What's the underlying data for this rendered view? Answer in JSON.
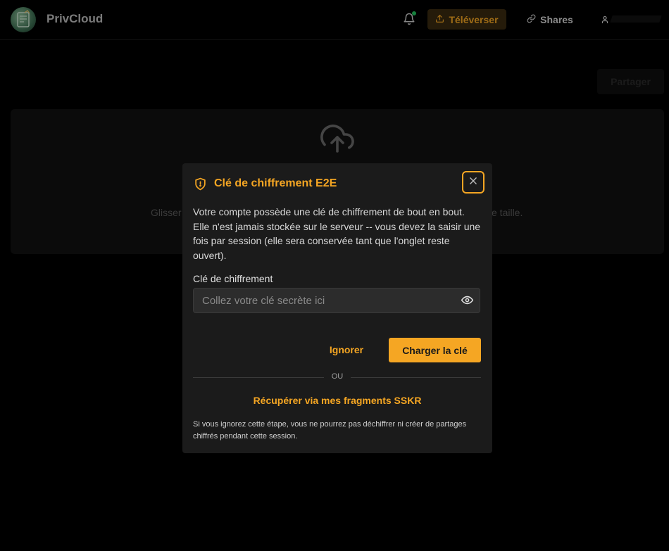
{
  "header": {
    "brand": "PrivCloud",
    "upload_label": "Téléverser",
    "shares_label": "Shares",
    "notification_color": "#22c55e"
  },
  "page": {
    "share_button": "Partager",
    "dropzone_text_left": "Glisser",
    "dropzone_text_right": "e taille."
  },
  "modal": {
    "title": "Clé de chiffrement E2E",
    "description": "Votre compte possède une clé de chiffrement de bout en bout. Elle n'est jamais stockée sur le serveur -- vous devez la saisir une fois par session (elle sera conservée tant que l'onglet reste ouvert).",
    "field_label": "Clé de chiffrement",
    "field_placeholder": "Collez votre clé secrète ici",
    "field_value": "",
    "ignore_label": "Ignorer",
    "load_label": "Charger la clé",
    "or_label": "OU",
    "sskr_label": "Récupérer via mes fragments SSKR",
    "footnote": "Si vous ignorez cette étape, vous ne pourrez pas déchiffrer ni créer de partages chiffrés pendant cette session."
  },
  "colors": {
    "accent": "#f5a623",
    "background": "#000000",
    "modal_bg": "#1b1b1b"
  },
  "icons": [
    "logo-icon",
    "bell-icon",
    "upload-icon",
    "link-icon",
    "user-icon",
    "cloud-upload-icon",
    "shield-icon",
    "close-icon",
    "eye-icon"
  ]
}
